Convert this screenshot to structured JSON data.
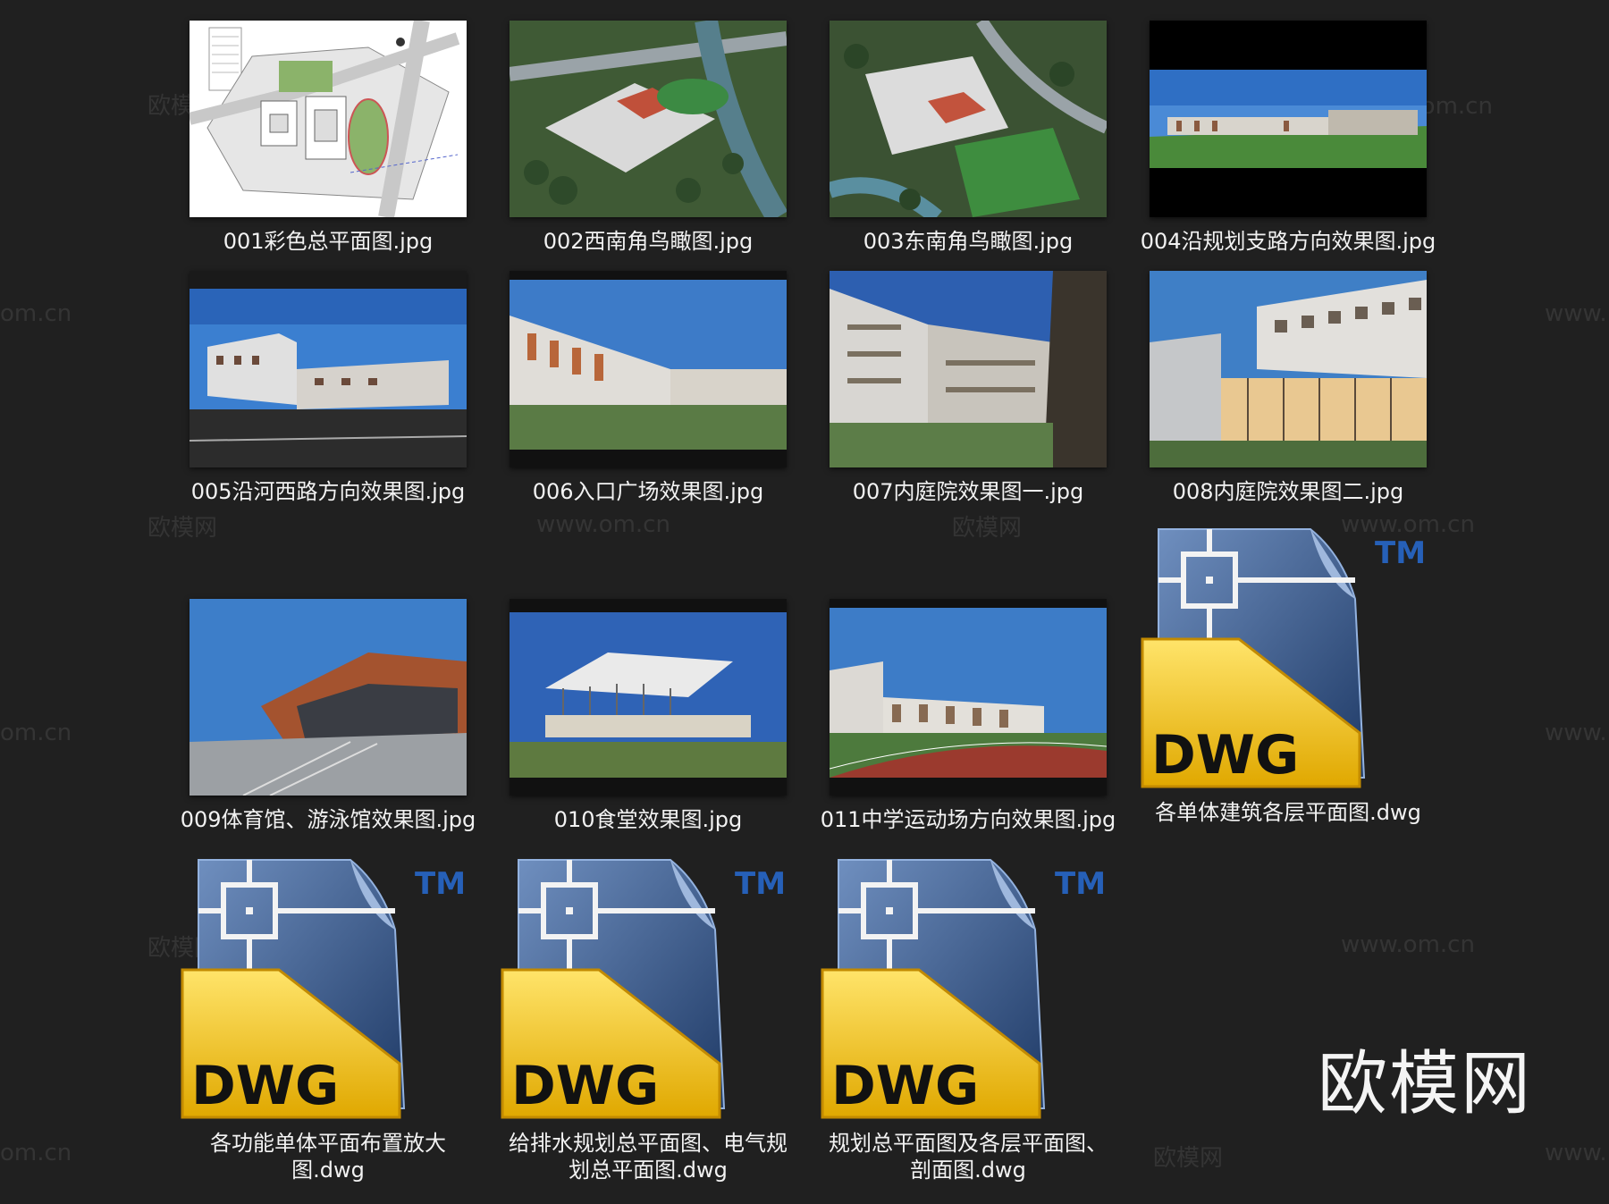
{
  "files": [
    {
      "name": "001彩色总平面图.jpg",
      "type": "site-plan"
    },
    {
      "name": "002西南角鸟瞰图.jpg",
      "type": "aerial"
    },
    {
      "name": "003东南角鸟瞰图.jpg",
      "type": "aerial"
    },
    {
      "name": "004沿规划支路方向效果图.jpg",
      "type": "wide"
    },
    {
      "name": "005沿河西路方向效果图.jpg",
      "type": "street"
    },
    {
      "name": "006入口广场效果图.jpg",
      "type": "plaza"
    },
    {
      "name": "007内庭院效果图一.jpg",
      "type": "courtyard"
    },
    {
      "name": "008内庭院效果图二.jpg",
      "type": "glass"
    },
    {
      "name": "009体育馆、游泳馆效果图.jpg",
      "type": "gym"
    },
    {
      "name": "010食堂效果图.jpg",
      "type": "canteen"
    },
    {
      "name": "011中学运动场方向效果图.jpg",
      "type": "track"
    },
    {
      "name": "各单体建筑各层平面图.dwg",
      "type": "dwg"
    },
    {
      "name": "各功能单体平面布置放大图.dwg",
      "type": "dwg"
    },
    {
      "name": "给排水规划总平面图、电气规划总平面图.dwg",
      "type": "dwg"
    },
    {
      "name": "规划总平面图及各层平面图、剖面图.dwg",
      "type": "dwg"
    }
  ],
  "dwg_icon": {
    "label": "DWG",
    "tm": "TM"
  },
  "watermarks": {
    "cn": "欧模网",
    "url": "www.om.cn",
    "url_partial": "om.cn",
    "url_prefix": "www."
  },
  "brand": "欧模网",
  "colors": {
    "background": "#202020",
    "dwg_yellow": "#f2c418",
    "dwg_blue": "#2d4e80"
  }
}
